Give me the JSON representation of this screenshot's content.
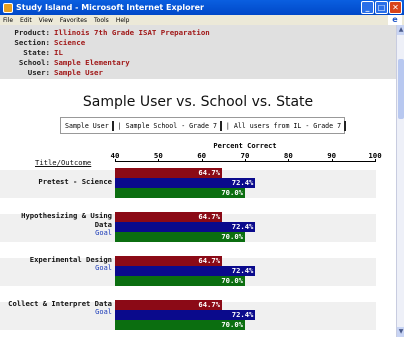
{
  "window": {
    "title": "Study Island - Microsoft Internet Explorer",
    "menu": [
      "File",
      "Edit",
      "View",
      "Favorites",
      "Tools",
      "Help"
    ]
  },
  "info": {
    "product_label": "Product:",
    "product": "Illinois 7th Grade ISAT Preparation",
    "section_label": "Section:",
    "section": "Science",
    "state_label": "State:",
    "state": "IL",
    "school_label": "School:",
    "school": "Sample Elementary",
    "user_label": "User:",
    "user": "Sample User"
  },
  "report": {
    "title": "Sample User vs. School vs. State",
    "column_header": "Title/Outcome"
  },
  "legend": {
    "user": "Sample User",
    "school": "| Sample School - Grade 7",
    "state": "| All users from IL - Grade 7"
  },
  "colors": {
    "user": "#8b0a16",
    "school": "#0a0a8c",
    "state": "#0b6e10"
  },
  "chart_data": {
    "type": "bar",
    "orientation": "horizontal",
    "xlabel": "Percent Correct",
    "xlim": [
      40,
      100
    ],
    "ticks": [
      40,
      50,
      60,
      70,
      80,
      90,
      100
    ],
    "categories": [
      {
        "label": "Pretest - Science",
        "goal": ""
      },
      {
        "label": "Hypothesizing & Using Data",
        "goal": "Goal"
      },
      {
        "label": "Experimental Design",
        "goal": "Goal"
      },
      {
        "label": "Collect & Interpret Data",
        "goal": "Goal"
      }
    ],
    "series": [
      {
        "name": "Sample User",
        "values": [
          64.7,
          64.7,
          64.7,
          64.7
        ],
        "labels": [
          "64.7%",
          "64.7%",
          "64.7%",
          "64.7%"
        ]
      },
      {
        "name": "Sample School - Grade 7",
        "values": [
          72.4,
          72.4,
          72.4,
          72.4
        ],
        "labels": [
          "72.4%",
          "72.4%",
          "72.4%",
          "72.4%"
        ]
      },
      {
        "name": "All users from IL - Grade 7",
        "values": [
          70.0,
          70.0,
          70.0,
          70.0
        ],
        "labels": [
          "70.0%",
          "70.0%",
          "70.0%",
          "70.0%"
        ]
      }
    ]
  }
}
